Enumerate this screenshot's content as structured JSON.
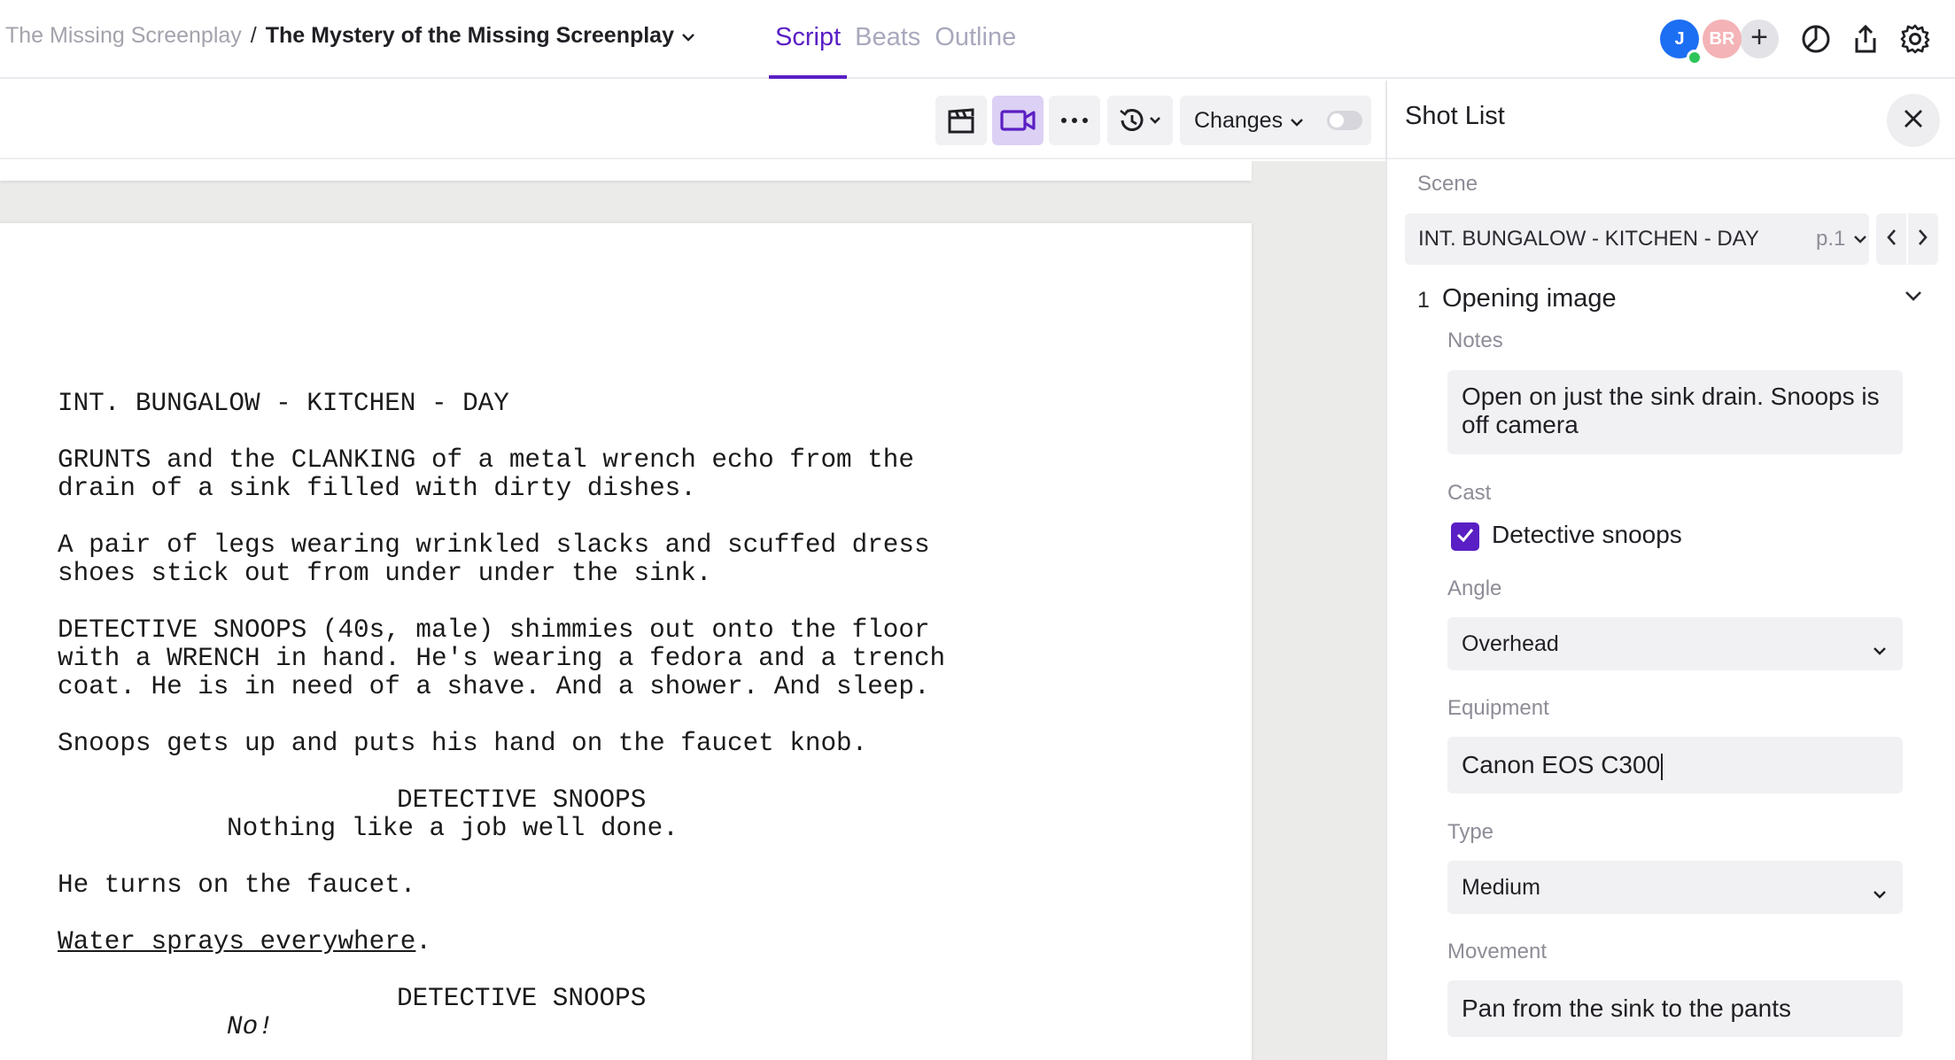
{
  "breadcrumb": {
    "parent": "The Missing Screenplay",
    "separator": "/",
    "current": "The Mystery of the Missing Screenplay"
  },
  "tabs": [
    {
      "label": "Script",
      "active": true
    },
    {
      "label": "Beats",
      "active": false
    },
    {
      "label": "Outline",
      "active": false
    }
  ],
  "collaborators": [
    {
      "initials": "J",
      "color": "#1c6ff2",
      "online": true
    },
    {
      "initials": "BR",
      "color": "#f4b3b6",
      "online": false
    }
  ],
  "header_icons": [
    "add-collaborator-icon",
    "stopwatch-icon",
    "share-icon",
    "settings-gear-icon"
  ],
  "toolbar": {
    "icons": [
      "clapperboard-icon",
      "video-camera-icon",
      "more-horizontal-icon",
      "history-icon"
    ],
    "changes_label": "Changes",
    "changes_enabled": false
  },
  "script": {
    "scene_heading": "INT. BUNGALOW - KITCHEN - DAY",
    "action_1": [
      "GRUNTS and the CLANKING of a metal wrench echo from the",
      "drain of a sink filled with dirty dishes."
    ],
    "action_2": [
      "A pair of legs wearing wrinkled slacks and scuffed dress",
      "shoes stick out from under under the sink."
    ],
    "action_3": [
      "DETECTIVE SNOOPS (40s, male) shimmies out onto the floor",
      "with a WRENCH in hand. He's wearing a fedora and a trench",
      "coat. He is in need of a shave. And a shower. And sleep."
    ],
    "action_4": "Snoops gets up and puts his hand on the faucet knob.",
    "character_1": "DETECTIVE SNOOPS",
    "dialogue_1": "Nothing like a job well done.",
    "action_5": "He turns on the faucet.",
    "action_6_underlined": "Water sprays everywhere",
    "action_6_end": ".",
    "character_2": "DETECTIVE SNOOPS",
    "dialogue_2": "No!"
  },
  "shot_list": {
    "title": "Shot List",
    "scene_label": "Scene",
    "scene_value": "INT. BUNGALOW - KITCHEN - DAY",
    "scene_page": "p.1",
    "shot": {
      "number": "1",
      "title": "Opening image",
      "notes_label": "Notes",
      "notes": "Open on just the sink drain. Snoops is off camera",
      "cast_label": "Cast",
      "cast": [
        {
          "name": "Detective snoops",
          "checked": true
        }
      ],
      "angle_label": "Angle",
      "angle": "Overhead",
      "equipment_label": "Equipment",
      "equipment": "Canon EOS C300",
      "type_label": "Type",
      "type": "Medium",
      "movement_label": "Movement",
      "movement": "Pan from the sink to the pants"
    }
  },
  "colors": {
    "accent": "#5a1fc4",
    "accent_light": "#dcd0f4",
    "field_bg": "#f1f1f4",
    "canvas_bg": "#ebebe9"
  }
}
